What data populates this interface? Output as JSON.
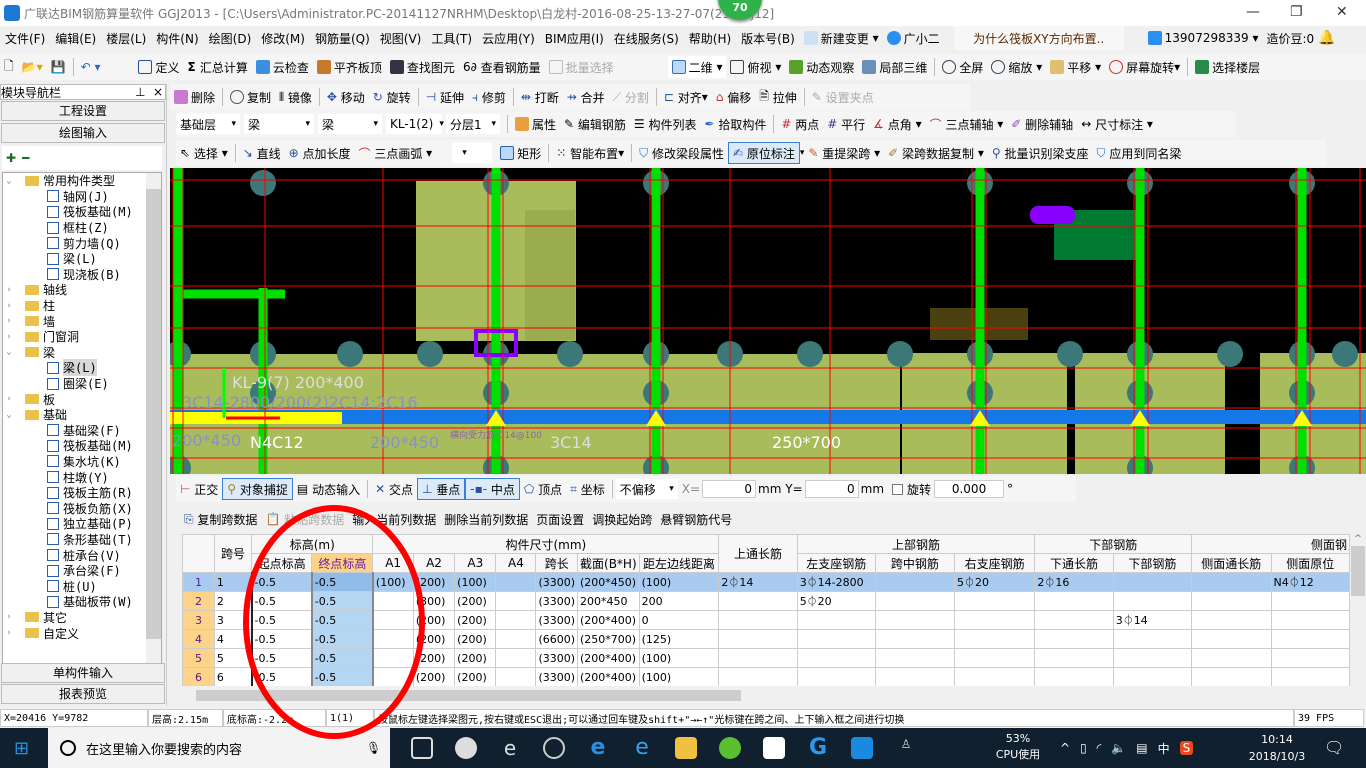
{
  "title": "广联达BIM钢筋算量软件 GGJ2013 - [C:\\Users\\Administrator.PC-20141127NRHM\\Desktop\\白龙村-2016-08-25-13-27-07(21...GJ12]",
  "badge": "70",
  "menu": [
    "文件(F)",
    "编辑(E)",
    "楼层(L)",
    "构件(N)",
    "绘图(D)",
    "修改(M)",
    "钢筋量(Q)",
    "视图(V)",
    "工具(T)",
    "云应用(Y)",
    "BIM应用(I)",
    "在线服务(S)",
    "帮助(H)",
    "版本号(B)"
  ],
  "menu_extra": {
    "new_change": "新建变更",
    "assistant": "广小二",
    "question": "为什么筏板XY方向布置..",
    "account": "13907298339",
    "beans": "造价豆:0"
  },
  "toolbar1": [
    "定义",
    "汇总计算",
    "云检查",
    "平齐板顶",
    "查找图元",
    "查看钢筋量",
    "批量选择"
  ],
  "toolbar1b": [
    "二维",
    "俯视",
    "动态观察",
    "局部三维",
    "全屏",
    "缩放",
    "平移",
    "屏幕旋转",
    "选择楼层"
  ],
  "toolbar2": [
    "删除",
    "复制",
    "镜像",
    "移动",
    "旋转",
    "延伸",
    "修剪",
    "打断",
    "合并",
    "分割",
    "对齐",
    "偏移",
    "拉伸",
    "设置夹点"
  ],
  "toolbar3": {
    "selects": [
      "基础层",
      "梁",
      "梁",
      "KL-1(2)",
      "分层1"
    ],
    "buttons": [
      "属性",
      "编辑钢筋",
      "构件列表",
      "拾取构件",
      "两点",
      "平行",
      "点角",
      "三点辅轴",
      "删除辅轴",
      "尺寸标注"
    ]
  },
  "toolbar4": [
    "选择",
    "直线",
    "点加长度",
    "三点画弧",
    "矩形",
    "智能布置",
    "修改梁段属性",
    "原位标注",
    "重提梁跨",
    "梁跨数据复制",
    "批量识别梁支座",
    "应用到同名梁"
  ],
  "sidebar": {
    "title": "模块导航栏",
    "project": "工程设置",
    "draw": "绘图输入",
    "single": "单构件输入",
    "report": "报表预览",
    "tree": [
      {
        "label": "常用构件类型",
        "level": 0,
        "open": true
      },
      {
        "label": "轴网(J)",
        "level": 1
      },
      {
        "label": "筏板基础(M)",
        "level": 1
      },
      {
        "label": "框柱(Z)",
        "level": 1
      },
      {
        "label": "剪力墙(Q)",
        "level": 1
      },
      {
        "label": "梁(L)",
        "level": 1
      },
      {
        "label": "现浇板(B)",
        "level": 1
      },
      {
        "label": "轴线",
        "level": 0
      },
      {
        "label": "柱",
        "level": 0
      },
      {
        "label": "墙",
        "level": 0
      },
      {
        "label": "门窗洞",
        "level": 0
      },
      {
        "label": "梁",
        "level": 0,
        "open": true
      },
      {
        "label": "梁(L)",
        "level": 1,
        "selected": true
      },
      {
        "label": "圈梁(E)",
        "level": 1
      },
      {
        "label": "板",
        "level": 0
      },
      {
        "label": "基础",
        "level": 0,
        "open": true
      },
      {
        "label": "基础梁(F)",
        "level": 1
      },
      {
        "label": "筏板基础(M)",
        "level": 1
      },
      {
        "label": "集水坑(K)",
        "level": 1
      },
      {
        "label": "柱墩(Y)",
        "level": 1
      },
      {
        "label": "筏板主筋(R)",
        "level": 1
      },
      {
        "label": "筏板负筋(X)",
        "level": 1
      },
      {
        "label": "独立基础(P)",
        "level": 1
      },
      {
        "label": "条形基础(T)",
        "level": 1
      },
      {
        "label": "桩承台(V)",
        "level": 1
      },
      {
        "label": "承台梁(F)",
        "level": 1
      },
      {
        "label": "桩(U)",
        "level": 1
      },
      {
        "label": "基础板带(W)",
        "level": 1
      },
      {
        "label": "其它",
        "level": 0
      },
      {
        "label": "自定义",
        "level": 0
      }
    ]
  },
  "canvas_labels": {
    "beam": "KL-9(7) 200*400",
    "rebar1": "3C14-2800/200(2)2C14;2C16",
    "sec1": "200*450",
    "n": "N4C12",
    "sec2": "200*450",
    "c14": "3C14",
    "sec3": "250*700",
    "dist": "横向受力筋:C14@100"
  },
  "snapbar": {
    "buttons": [
      "正交",
      "对象捕捉",
      "动态输入",
      "交点",
      "垂点",
      "中点",
      "顶点",
      "坐标"
    ],
    "offset": "不偏移",
    "x_label": "X=",
    "x": "0",
    "y_label": "mm Y=",
    "y": "0",
    "unit": "mm",
    "rotate": "旋转",
    "rotate_val": "0.000",
    "deg": "°"
  },
  "tablebar": [
    "复制跨数据",
    "粘贴跨数据",
    "输入当前列数据",
    "删除当前列数据",
    "页面设置",
    "调换起始跨",
    "悬臂钢筋代号"
  ],
  "table": {
    "groups": {
      "span": "跨号",
      "elev": "标高(m)",
      "size": "构件尺寸(mm)",
      "top_through": "上通长筋",
      "top": "上部钢筋",
      "bottom": "下部钢筋",
      "side": "侧面钢"
    },
    "cols": [
      "起点标高",
      "终点标高",
      "A1",
      "A2",
      "A3",
      "A4",
      "跨长",
      "截面(B*H)",
      "距左边线距离",
      "左支座钢筋",
      "跨中钢筋",
      "右支座钢筋",
      "下通长筋",
      "下部钢筋",
      "侧面通长筋",
      "侧面原位"
    ],
    "rows": [
      [
        "1",
        "1",
        "-0.5",
        "-0.5",
        "(100)",
        "(200)",
        "(100)",
        "",
        "(3300)",
        "(200*450)",
        "(100)",
        "2⏀14",
        "3⏀14-2800",
        "",
        "5⏀20",
        "2⏀16",
        "",
        "",
        "N4⏀12"
      ],
      [
        "2",
        "2",
        "-0.5",
        "-0.5",
        "",
        "(300)",
        "(200)",
        "",
        "(3300)",
        "200*450",
        "200",
        "",
        "5⏀20",
        "",
        "",
        "",
        "",
        "",
        ""
      ],
      [
        "3",
        "3",
        "-0.5",
        "-0.5",
        "",
        "(200)",
        "(200)",
        "",
        "(3300)",
        "(200*400)",
        "0",
        "",
        "",
        "",
        "",
        "",
        "3⏀14",
        "",
        ""
      ],
      [
        "4",
        "4",
        "-0.5",
        "-0.5",
        "",
        "(200)",
        "(200)",
        "",
        "(6600)",
        "(250*700)",
        "(125)",
        "",
        "",
        "",
        "",
        "",
        "",
        "",
        ""
      ],
      [
        "5",
        "5",
        "-0.5",
        "-0.5",
        "",
        "(200)",
        "(200)",
        "",
        "(3300)",
        "(200*400)",
        "(100)",
        "",
        "",
        "",
        "",
        "",
        "",
        "",
        ""
      ],
      [
        "6",
        "6",
        "-0.5",
        "-0.5",
        "",
        "(200)",
        "(200)",
        "",
        "(3300)",
        "(200*400)",
        "(100)",
        "",
        "",
        "",
        "",
        "",
        "",
        "",
        ""
      ]
    ]
  },
  "status": {
    "coords": "X=20416 Y=9782",
    "floor_h": "层高:2.15m",
    "base_h": "底标高:-2.2m",
    "count": "1(1)",
    "hint": "按鼠标左键选择梁图元,按右键或ESC退出;可以通过回车键及shift+\"→←↑\"光标键在跨之间、上下输入框之间进行切换",
    "fps": "39 FPS"
  },
  "taskbar": {
    "search": "在这里输入你要搜索的内容",
    "cpu": "53%",
    "cpu_label": "CPU使用",
    "ime": "中",
    "time": "10:14",
    "date": "2018/10/3"
  },
  "colors": {
    "annotation": "#ff0000",
    "beam": "#00e000",
    "selected_beam": "#ffff00",
    "blue_beam": "#1478e6",
    "slab": "#a8bc5c"
  }
}
